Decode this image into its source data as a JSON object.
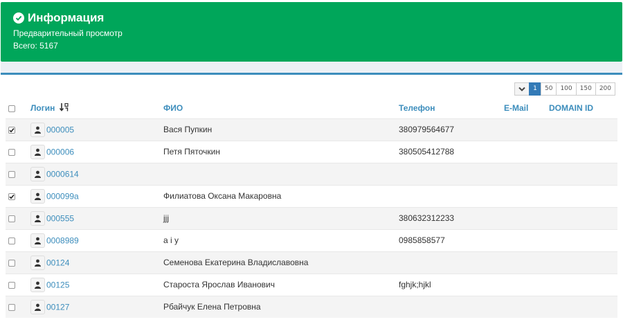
{
  "alert": {
    "title": "Информация",
    "line1": "Предварительный просмотр",
    "line2": "Всего: 5167",
    "color": "#00a65a"
  },
  "pager": {
    "options": [
      "1",
      "50",
      "100",
      "150",
      "200"
    ],
    "active": "1"
  },
  "table": {
    "headers": {
      "login": "Логин",
      "fio": "ФИО",
      "phone": "Телефон",
      "email": "E-Mail",
      "domain": "DOMAIN ID"
    },
    "rows": [
      {
        "checked": true,
        "login": "000005",
        "fio": "Вася Пупкин",
        "phone": "380979564677",
        "email": "",
        "domain": ""
      },
      {
        "checked": false,
        "login": "000006",
        "fio": "Петя Пяточкин",
        "phone": "380505412788",
        "email": "",
        "domain": ""
      },
      {
        "checked": false,
        "login": "0000614",
        "fio": "",
        "phone": "",
        "email": "",
        "domain": ""
      },
      {
        "checked": true,
        "login": "000099a",
        "fio": "Филиатова Оксана Макаровна",
        "phone": "",
        "email": "",
        "domain": ""
      },
      {
        "checked": false,
        "login": "000555",
        "fio": "jjj",
        "phone": "380632312233",
        "email": "",
        "domain": ""
      },
      {
        "checked": false,
        "login": "0008989",
        "fio": "a i y",
        "phone": "0985858577",
        "email": "",
        "domain": ""
      },
      {
        "checked": false,
        "login": "00124",
        "fio": "Семенова Екатерина Владиславовна",
        "phone": "",
        "email": "",
        "domain": ""
      },
      {
        "checked": false,
        "login": "00125",
        "fio": "Староста Ярослав Иванович",
        "phone": "fghjk;hjkl",
        "email": "",
        "domain": ""
      },
      {
        "checked": false,
        "login": "00127",
        "fio": "Рбайчук Елена Петровна",
        "phone": "",
        "email": "",
        "domain": ""
      }
    ]
  }
}
